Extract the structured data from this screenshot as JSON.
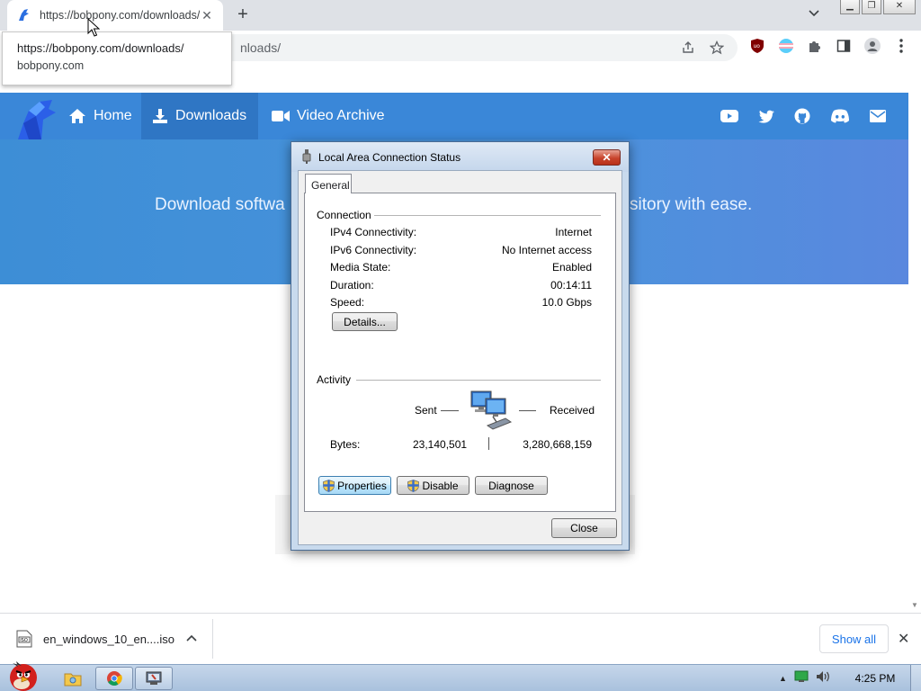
{
  "browser": {
    "tab": {
      "title": "https://bobpony.com/downloads/",
      "close_glyph": "✕"
    },
    "new_tab_glyph": "+",
    "omnibox": {
      "url_visible": "nloads/"
    },
    "tooltip": {
      "url": "https://bobpony.com/downloads/",
      "domain": "bobpony.com"
    }
  },
  "site": {
    "nav": [
      {
        "label": "Home",
        "icon": "home-icon"
      },
      {
        "label": "Downloads",
        "icon": "download-icon",
        "active": true
      },
      {
        "label": "Video Archive",
        "icon": "video-icon"
      }
    ],
    "social_icons": [
      "youtube-icon",
      "twitter-icon",
      "github-icon",
      "discord-icon",
      "mail-icon"
    ],
    "hero_left": "Download softwa",
    "hero_right": "sitory with ease."
  },
  "dialog": {
    "title": "Local Area Connection Status",
    "close_glyph": "✕",
    "tab": "General",
    "connection": {
      "label": "Connection",
      "rows": [
        {
          "label": "IPv4 Connectivity:",
          "value": "Internet"
        },
        {
          "label": "IPv6 Connectivity:",
          "value": "No Internet access"
        },
        {
          "label": "Media State:",
          "value": "Enabled"
        },
        {
          "label": "Duration:",
          "value": "00:14:11"
        },
        {
          "label": "Speed:",
          "value": "10.0 Gbps"
        }
      ],
      "details_button": "Details..."
    },
    "activity": {
      "label": "Activity",
      "sent_label": "Sent",
      "received_label": "Received",
      "bytes_label": "Bytes:",
      "bytes_sent": "23,140,501",
      "bytes_received": "3,280,668,159"
    },
    "buttons": {
      "properties": "Properties",
      "disable": "Disable",
      "diagnose": "Diagnose",
      "close": "Close"
    }
  },
  "downloads_bar": {
    "file_name": "en_windows_10_en....iso",
    "show_all": "Show all"
  },
  "taskbar": {
    "clock": "4:25 PM"
  },
  "colors": {
    "site_nav": "#3a87d8",
    "hero": "#4a93dc",
    "dialog_frame": "#c8daed"
  }
}
